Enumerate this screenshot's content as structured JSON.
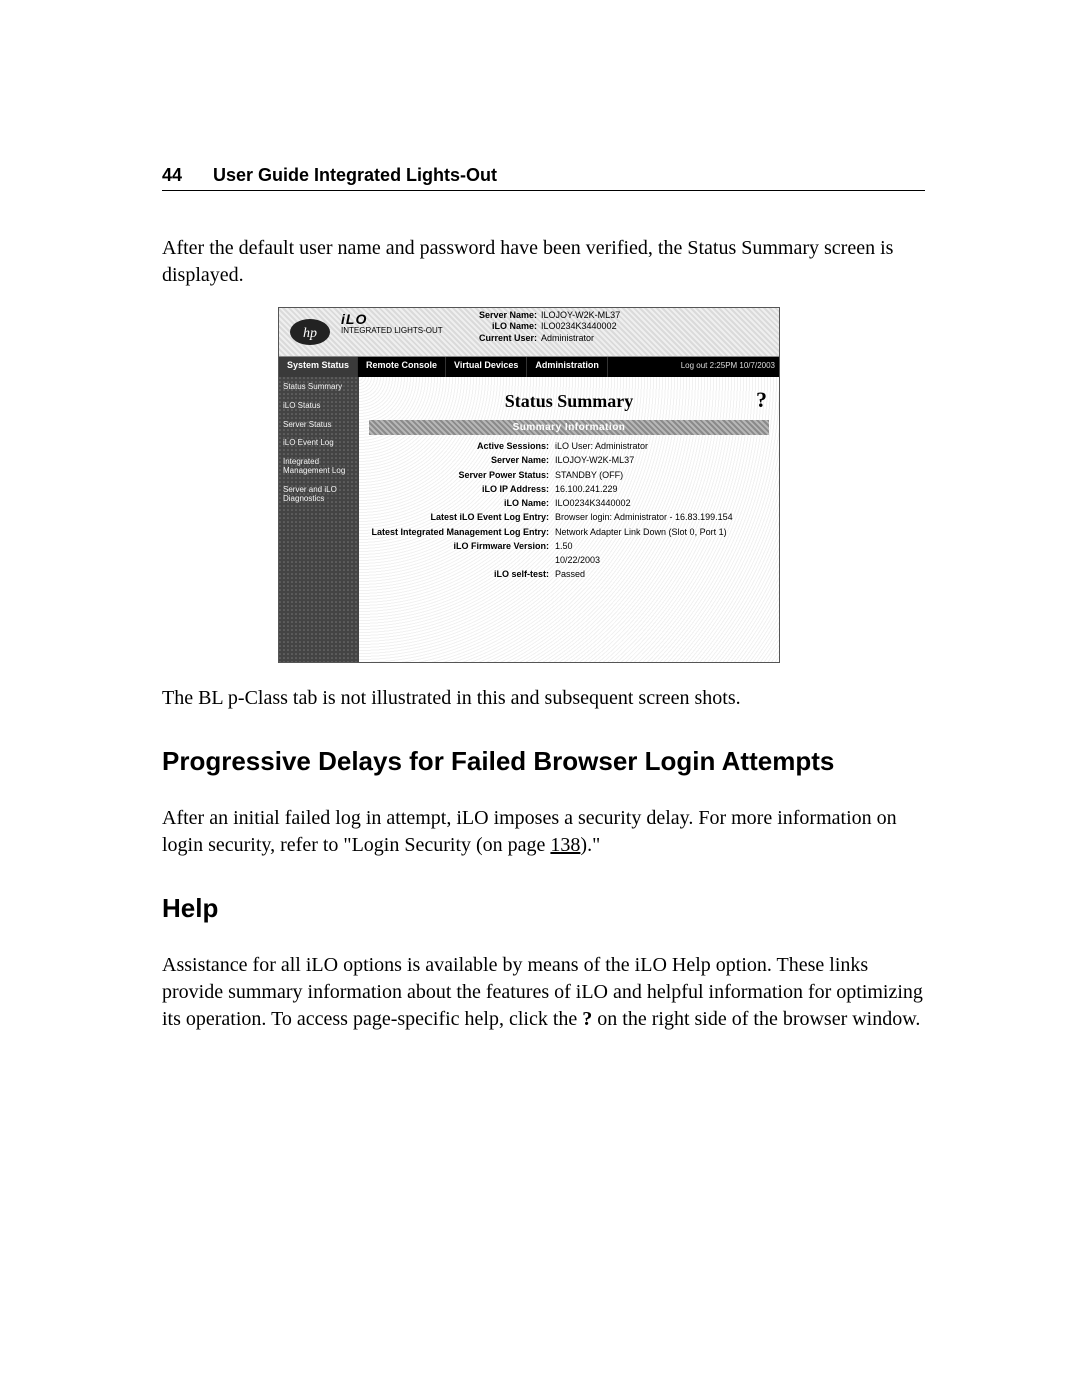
{
  "header": {
    "page_number": "44",
    "running_title": "User Guide Integrated Lights-Out"
  },
  "intro_paragraph": "After the default user name and password have been verified, the Status Summary screen is displayed.",
  "screenshot": {
    "product_short": "iLO",
    "product_long": "INTEGRATED LIGHTS-OUT",
    "header_info": {
      "server_name_label": "Server Name:",
      "server_name_value": "ILOJOY-W2K-ML37",
      "ilo_name_label": "iLO Name:",
      "ilo_name_value": "ILO0234K3440002",
      "current_user_label": "Current User:",
      "current_user_value": "Administrator"
    },
    "tabs": [
      "System Status",
      "Remote Console",
      "Virtual Devices",
      "Administration"
    ],
    "active_tab_index": 0,
    "logout_text": "Log out 2:25PM 10/7/2003",
    "sidebar": [
      "Status Summary",
      "iLO Status",
      "Server Status",
      "iLO Event Log",
      "Integrated Management Log",
      "Server and iLO Diagnostics"
    ],
    "panel_title": "Status Summary",
    "help_symbol": "?",
    "section_band": "Summary Information",
    "rows": [
      {
        "label": "Active Sessions:",
        "value": "iLO User: Administrator"
      },
      {
        "label": "Server Name:",
        "value": "ILOJOY-W2K-ML37"
      },
      {
        "label": "Server Power Status:",
        "value": "STANDBY (OFF)"
      },
      {
        "label": "iLO IP Address:",
        "value": "16.100.241.229"
      },
      {
        "label": "iLO Name:",
        "value": "ILO0234K3440002"
      },
      {
        "label": "Latest iLO Event Log Entry:",
        "value": "Browser login: Administrator - 16.83.199.154"
      },
      {
        "label": "Latest Integrated Management Log Entry:",
        "value": "Network Adapter Link Down (Slot 0, Port 1)"
      },
      {
        "label": "iLO Firmware Version:",
        "value": "1.50"
      },
      {
        "label": "",
        "value": "10/22/2003"
      },
      {
        "label": "iLO self-test:",
        "value": "Passed"
      }
    ]
  },
  "caption_after_figure": "The BL p-Class tab is not illustrated in this and subsequent screen shots.",
  "sections": {
    "delays": {
      "heading": "Progressive Delays for Failed Browser Login Attempts",
      "text_before_link": "After an initial failed log in attempt, iLO imposes a security delay. For more information on login security, refer to \"Login Security (on page ",
      "link_text": "138",
      "text_after_link": ").\""
    },
    "help": {
      "heading": "Help",
      "text_before_q": "Assistance for all iLO options is available by means of the iLO Help option. These links provide summary information about the features of iLO and helpful information for optimizing its operation. To access page-specific help, click the ",
      "q": "?",
      "text_after_q": " on the right side of the browser window."
    }
  }
}
